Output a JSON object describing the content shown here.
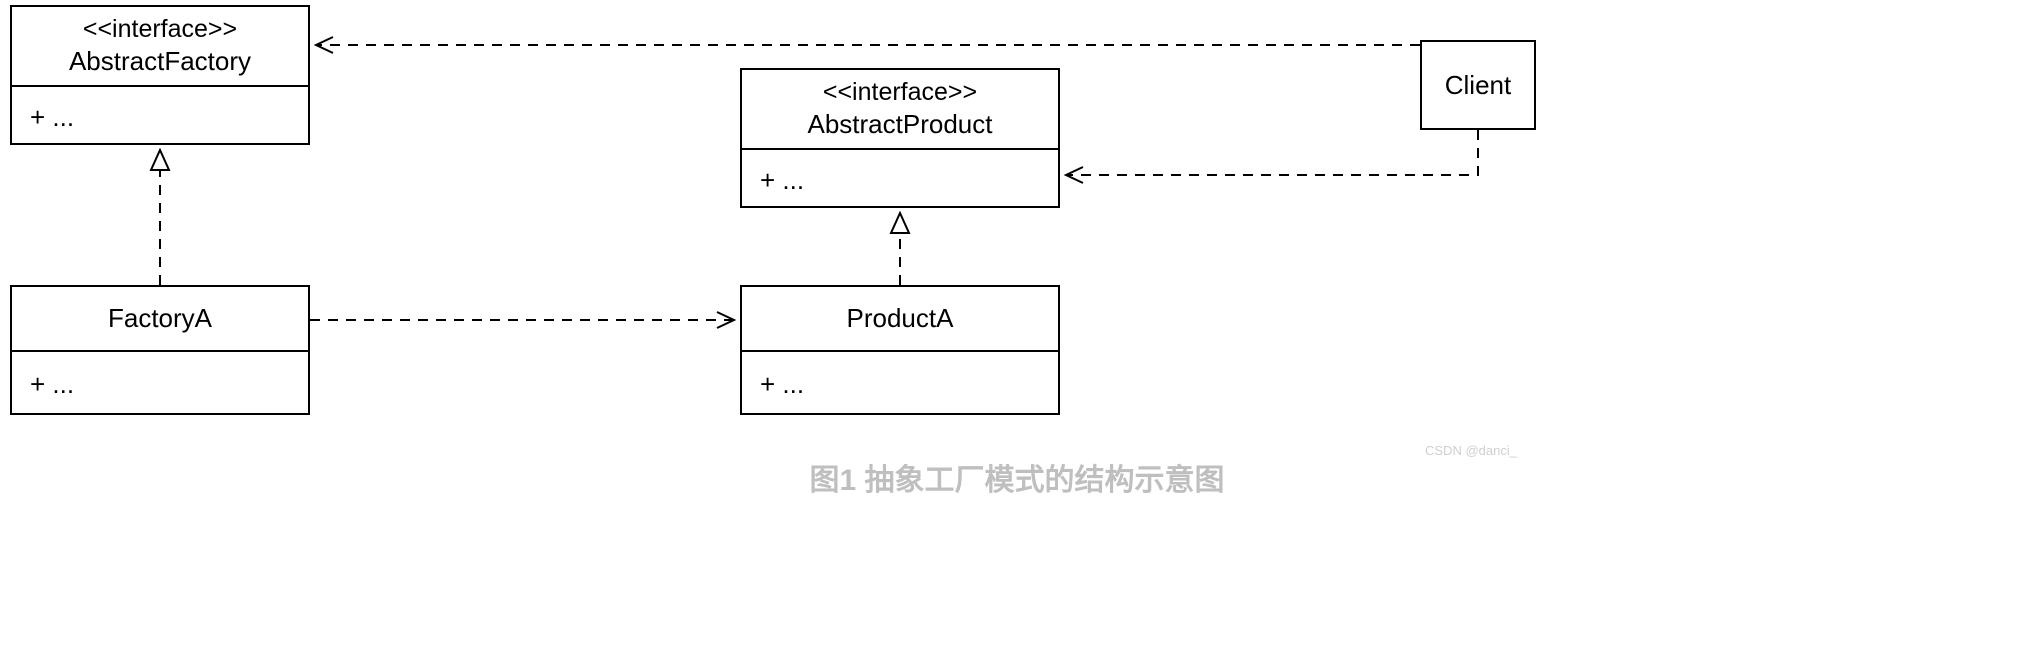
{
  "nodes": {
    "abstractFactory": {
      "stereotype": "<<interface>>",
      "name": "AbstractFactory",
      "members": "+ ..."
    },
    "abstractProduct": {
      "stereotype": "<<interface>>",
      "name": "AbstractProduct",
      "members": "+ ..."
    },
    "factoryA": {
      "name": "FactoryA",
      "members": "+ ..."
    },
    "productA": {
      "name": "ProductA",
      "members": "+ ..."
    },
    "client": {
      "name": "Client"
    }
  },
  "relations": [
    {
      "from": "Client",
      "to": "AbstractFactory",
      "type": "dependency"
    },
    {
      "from": "Client",
      "to": "AbstractProduct",
      "type": "dependency"
    },
    {
      "from": "FactoryA",
      "to": "AbstractFactory",
      "type": "realization"
    },
    {
      "from": "ProductA",
      "to": "AbstractProduct",
      "type": "realization"
    },
    {
      "from": "FactoryA",
      "to": "ProductA",
      "type": "dependency"
    }
  ],
  "caption": "图1 抽象工厂模式的结构示意图",
  "watermark": "CSDN @danci_"
}
